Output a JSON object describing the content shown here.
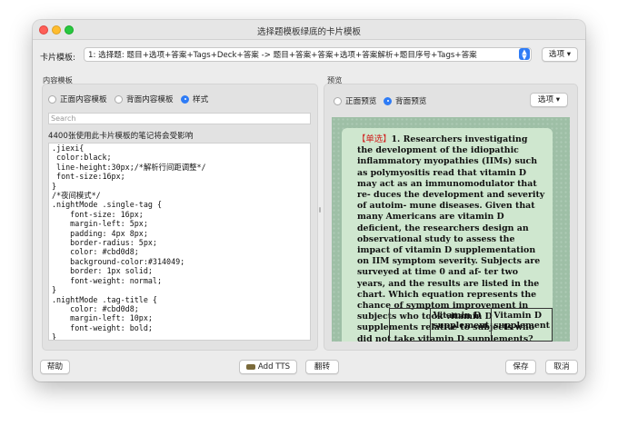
{
  "window": {
    "title": "选择题模板绿底的卡片模板"
  },
  "template": {
    "label": "卡片模板:",
    "selected": "1: 选择题: 题目+选项+答案+Tags+Deck+答案 -> 题目+答案+答案+选项+答案解析+题目序号+Tags+答案",
    "options_button": "选项 ▾"
  },
  "content": {
    "section_label": "内容模板",
    "radios": [
      {
        "label": "正面内容模板",
        "selected": false
      },
      {
        "label": "背面内容模板",
        "selected": false
      },
      {
        "label": "样式",
        "selected": true
      }
    ],
    "search_placeholder": "Search",
    "usage_note": "4400张使用此卡片模板的笔记将会受影响",
    "css_code": ".jiexi{\n color:black;\n line-height:30px;/*解析行间距调整*/\n font-size:16px;\n}\n/*夜间模式*/\n.nightMode .single-tag {\n    font-size: 16px;\n    margin-left: 5px;\n    padding: 4px 8px;\n    border-radius: 5px;\n    color: #cbd0d8;\n    background-color:#314049;\n    border: 1px solid;\n    font-weight: normal;\n}\n.nightMode .tag-title {\n    color: #cbd0d8;\n    margin-left: 10px;\n    font-weight: bold;\n}"
  },
  "preview": {
    "section_label": "预览",
    "radios": [
      {
        "label": "正面预览",
        "selected": false
      },
      {
        "label": "背面预览",
        "selected": true
      }
    ],
    "options_button": "选项 ▾",
    "card": {
      "tag": "【单选】",
      "question": "1. Researchers investigating the development of the idiopathic inflammatory myopathies (IIMs) such as polymyositis read that vitamin D may act as an immunomodulator that re- duces the development and severity of autoim- mune diseases. Given that many Americans are vitamin D deficient, the researchers design an observational study to assess the impact of vitamin D supplementation on IIM symptom severity. Subjects are surveyed at time 0 and af- ter two years, and the results are listed in the chart. Which equation represents the chance of symptom improvement in subjects who took vitamin D supplements relative to subjects who did not take vitamin D supplements?",
      "table_headers": [
        "",
        "Vitamin D supplement",
        "Vitamin D supplement"
      ]
    }
  },
  "footer": {
    "help": "帮助",
    "add_tts": "Add TTS",
    "flip": "翻转",
    "save": "保存",
    "cancel": "取消"
  }
}
